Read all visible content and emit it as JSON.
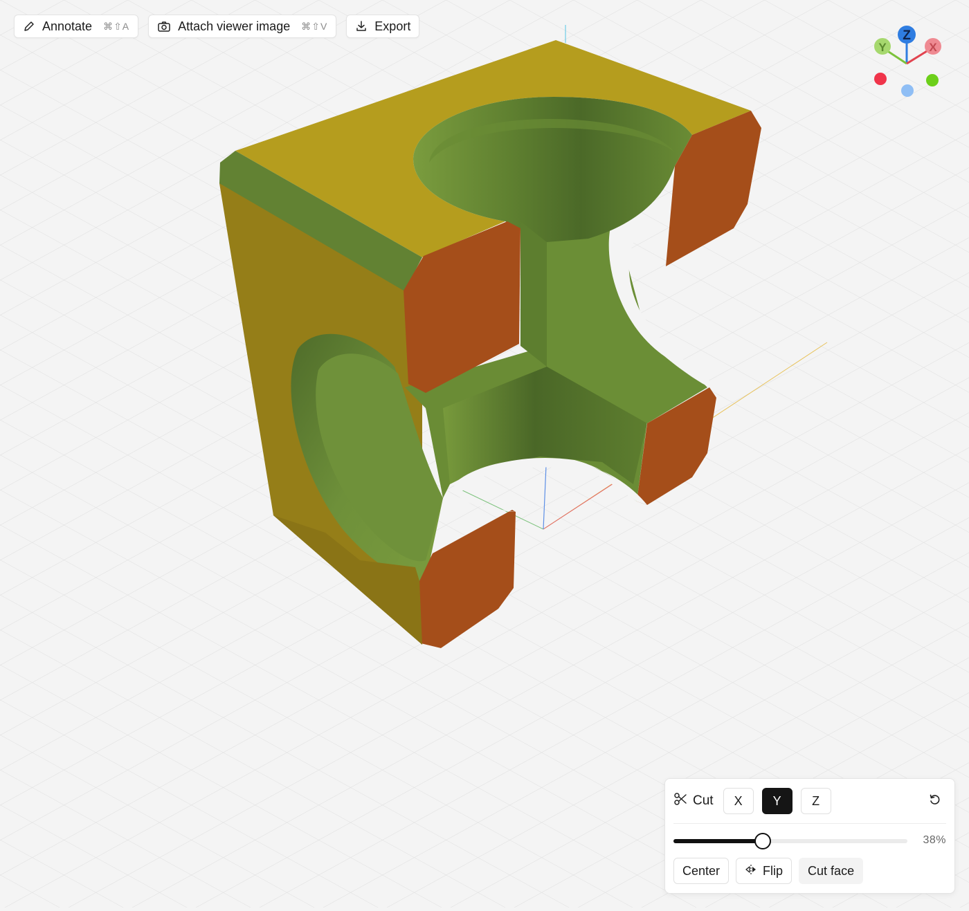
{
  "toolbar": {
    "annotate": {
      "label": "Annotate",
      "shortcut": "⌘⇧A",
      "icon": "pencil-icon"
    },
    "attach": {
      "label": "Attach viewer image",
      "shortcut": "⌘⇧V",
      "icon": "camera-icon"
    },
    "export": {
      "label": "Export",
      "icon": "download-icon"
    }
  },
  "gizmo": {
    "axes": [
      {
        "label": "Z",
        "color": "#2f7de1"
      },
      {
        "label": "Y",
        "color": "#7cc23b"
      },
      {
        "label": "X",
        "color": "#e2434f"
      }
    ]
  },
  "cut_panel": {
    "title": "Cut",
    "icon": "scissors-icon",
    "axes": [
      "X",
      "Y",
      "Z"
    ],
    "active_axis": "Y",
    "reset_icon": "reset-icon",
    "slider_fraction": 0.38,
    "slider_label": "38%",
    "buttons": {
      "center": "Center",
      "flip": "Flip",
      "cut_face": "Cut face"
    }
  },
  "model": {
    "face_colors": {
      "top": "#b59d1e",
      "side": "#957e18",
      "cut": "#a54e1a",
      "inner": "#6a8c35",
      "inner_dark": "#4f6c2a",
      "inner_light": "#7a9c3e"
    }
  }
}
